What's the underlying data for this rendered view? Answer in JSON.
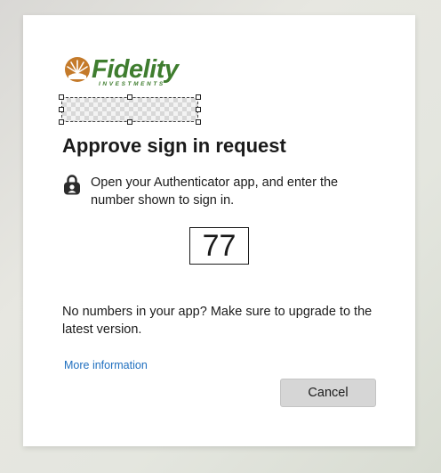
{
  "brand": {
    "name": "Fidelity",
    "subline": "INVESTMENTS",
    "color": "#3f7d2f",
    "mark_color": "#c47a2a"
  },
  "dialog": {
    "title": "Approve sign in request",
    "instruction": "Open your Authenticator app, and enter the number shown to sign in.",
    "number": "77",
    "help_text": "No numbers in your app? Make sure to upgrade to the latest version.",
    "more_info_link": "More information",
    "cancel_label": "Cancel"
  },
  "icons": {
    "instruction_icon": "lock-icon",
    "logo_mark": "sunburst-logo-icon"
  }
}
